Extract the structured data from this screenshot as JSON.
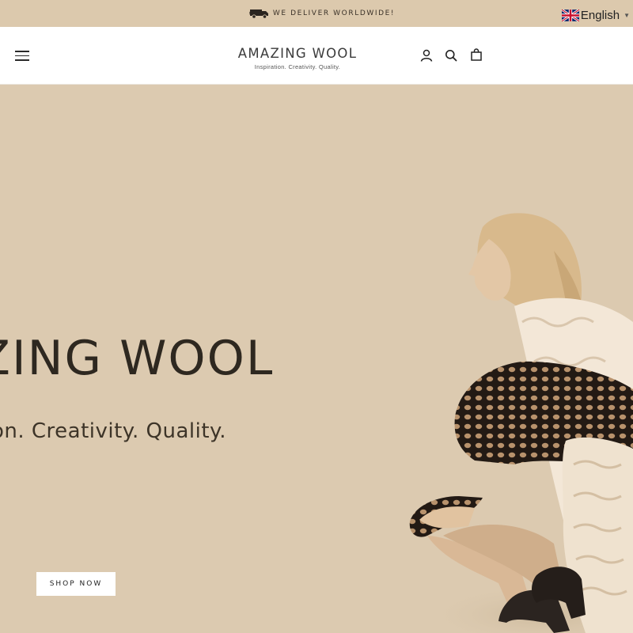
{
  "announcement": {
    "text": "WE DELIVER WORLDWIDE!",
    "icon": "truck-icon"
  },
  "language": {
    "label": "English",
    "flag": "uk-flag-icon"
  },
  "header": {
    "logo_title": "AMAZING WOOL",
    "logo_tagline": "Inspiration. Creativity. Quality.",
    "icons": [
      "menu-icon",
      "account-icon",
      "search-icon",
      "cart-icon"
    ]
  },
  "hero": {
    "title": "AMAZING WOOL",
    "subtitle": "Inspiration. Creativity. Quality.",
    "cta_label": "SHOP NOW",
    "image": "model-in-chunky-knit-blanket-photo"
  },
  "colors": {
    "background": "#dccab0",
    "header_bg": "#ffffff",
    "text_dark": "#2e2820",
    "button_bg": "#ffffff"
  }
}
